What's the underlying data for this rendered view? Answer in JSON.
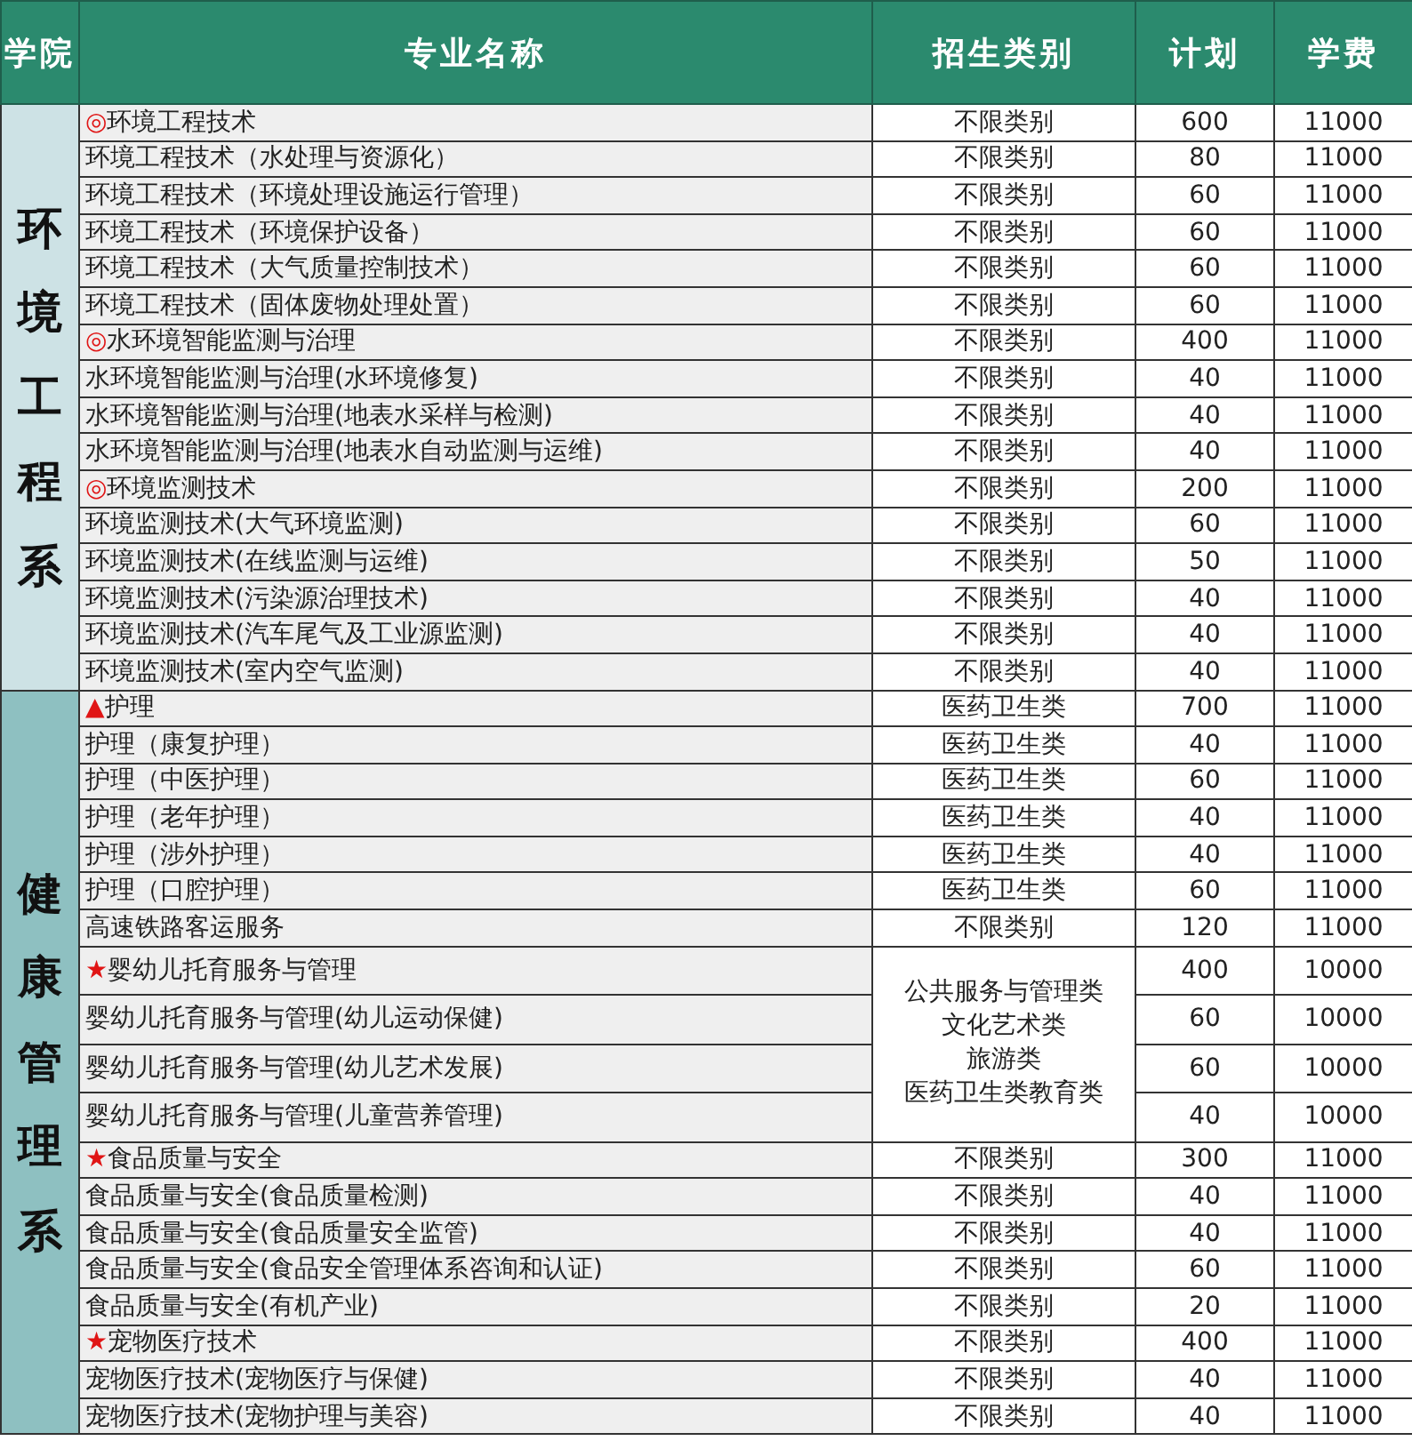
{
  "table": {
    "columns": [
      "学院",
      "专业名称",
      "招生类别",
      "计划",
      "学费"
    ],
    "departments": [
      {
        "name": "环境工程系",
        "color": "#cde2e5",
        "majors": [
          {
            "mark": "◎",
            "name": "环境工程技术",
            "category": [
              "不限类别"
            ],
            "plan": "600",
            "fee": "11000"
          },
          {
            "name": "环境工程技术（水处理与资源化）",
            "category": [
              "不限类别"
            ],
            "plan": "80",
            "fee": "11000"
          },
          {
            "name": "环境工程技术（环境处理设施运行管理）",
            "category": [
              "不限类别"
            ],
            "plan": "60",
            "fee": "11000"
          },
          {
            "name": "环境工程技术（环境保护设备）",
            "category": [
              "不限类别"
            ],
            "plan": "60",
            "fee": "11000"
          },
          {
            "name": "环境工程技术（大气质量控制技术）",
            "category": [
              "不限类别"
            ],
            "plan": "60",
            "fee": "11000"
          },
          {
            "name": "环境工程技术（固体废物处理处置）",
            "category": [
              "不限类别"
            ],
            "plan": "60",
            "fee": "11000"
          },
          {
            "mark": "◎",
            "name": "水环境智能监测与治理",
            "category": [
              "不限类别"
            ],
            "plan": "400",
            "fee": "11000"
          },
          {
            "name": "水环境智能监测与治理(水环境修复)",
            "category": [
              "不限类别"
            ],
            "plan": "40",
            "fee": "11000"
          },
          {
            "name": "水环境智能监测与治理(地表水采样与检测)",
            "category": [
              "不限类别"
            ],
            "plan": "40",
            "fee": "11000"
          },
          {
            "name": "水环境智能监测与治理(地表水自动监测与运维)",
            "category": [
              "不限类别"
            ],
            "plan": "40",
            "fee": "11000"
          },
          {
            "mark": "◎",
            "name": "环境监测技术",
            "category": [
              "不限类别"
            ],
            "plan": "200",
            "fee": "11000"
          },
          {
            "name": "环境监测技术(大气环境监测)",
            "category": [
              "不限类别"
            ],
            "plan": "60",
            "fee": "11000"
          },
          {
            "name": "环境监测技术(在线监测与运维)",
            "category": [
              "不限类别"
            ],
            "plan": "50",
            "fee": "11000"
          },
          {
            "name": "环境监测技术(污染源治理技术)",
            "category": [
              "不限类别"
            ],
            "plan": "40",
            "fee": "11000"
          },
          {
            "name": "环境监测技术(汽车尾气及工业源监测)",
            "category": [
              "不限类别"
            ],
            "plan": "40",
            "fee": "11000"
          },
          {
            "name": "环境监测技术(室内空气监测)",
            "category": [
              "不限类别"
            ],
            "plan": "40",
            "fee": "11000"
          }
        ]
      },
      {
        "name": "健康管理系",
        "color": "#8ec0c1",
        "majors": [
          {
            "mark": "▲",
            "name": "护理",
            "category": [
              "医药卫生类"
            ],
            "plan": "700",
            "fee": "11000"
          },
          {
            "name": "护理（康复护理）",
            "category": [
              "医药卫生类"
            ],
            "plan": "40",
            "fee": "11000"
          },
          {
            "name": "护理（中医护理）",
            "category": [
              "医药卫生类"
            ],
            "plan": "60",
            "fee": "11000"
          },
          {
            "name": "护理（老年护理）",
            "category": [
              "医药卫生类"
            ],
            "plan": "40",
            "fee": "11000"
          },
          {
            "name": "护理（涉外护理）",
            "category": [
              "医药卫生类"
            ],
            "plan": "40",
            "fee": "11000"
          },
          {
            "name": "护理（口腔护理）",
            "category": [
              "医药卫生类"
            ],
            "plan": "60",
            "fee": "11000"
          },
          {
            "name": "高速铁路客运服务",
            "category": [
              "不限类别"
            ],
            "plan": "120",
            "fee": "11000"
          },
          {
            "mark": "★",
            "name": "婴幼儿托育服务与管理",
            "category": [
              "公共服务与管理类",
              "文化艺术类",
              "旅游类",
              "医药卫生类教育类"
            ],
            "plan": "400",
            "fee": "10000"
          },
          {
            "name": "婴幼儿托育服务与管理(幼儿运动保健)",
            "plan": "60",
            "fee": "10000"
          },
          {
            "name": "婴幼儿托育服务与管理(幼儿艺术发展)",
            "plan": "60",
            "fee": "10000"
          },
          {
            "name": "婴幼儿托育服务与管理(儿童营养管理)",
            "plan": "40",
            "fee": "10000"
          },
          {
            "mark": "★",
            "name": "食品质量与安全",
            "category": [
              "不限类别"
            ],
            "plan": "300",
            "fee": "11000"
          },
          {
            "name": "食品质量与安全(食品质量检测)",
            "category": [
              "不限类别"
            ],
            "plan": "40",
            "fee": "11000"
          },
          {
            "name": "食品质量与安全(食品质量安全监管)",
            "category": [
              "不限类别"
            ],
            "plan": "40",
            "fee": "11000"
          },
          {
            "name": "食品质量与安全(食品安全管理体系咨询和认证)",
            "category": [
              "不限类别"
            ],
            "plan": "60",
            "fee": "11000"
          },
          {
            "name": "食品质量与安全(有机产业)",
            "category": [
              "不限类别"
            ],
            "plan": "20",
            "fee": "11000"
          },
          {
            "mark": "★",
            "name": "宠物医疗技术",
            "category": [
              "不限类别"
            ],
            "plan": "400",
            "fee": "11000"
          },
          {
            "name": "宠物医疗技术(宠物医疗与保健)",
            "category": [
              "不限类别"
            ],
            "plan": "40",
            "fee": "11000"
          },
          {
            "name": "宠物医疗技术(宠物护理与美容)",
            "category": [
              "不限类别"
            ],
            "plan": "40",
            "fee": "11000"
          }
        ]
      }
    ]
  }
}
